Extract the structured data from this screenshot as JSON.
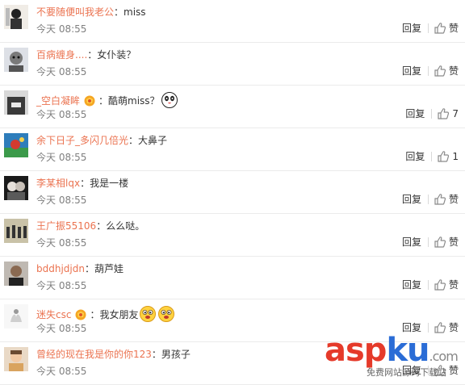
{
  "labels": {
    "reply": "回复",
    "like": "赞",
    "colon": "："
  },
  "colors": {
    "username": "#eb7350",
    "timestamp": "#808080",
    "text": "#333333"
  },
  "comments": [
    {
      "username": "不要随便叫我老公",
      "text": "miss",
      "time": "今天 08:55",
      "like": "赞",
      "badge": false,
      "emojis": []
    },
    {
      "username": "百病缠身....",
      "text": "女仆装？",
      "time": "今天 08:55",
      "like": "赞",
      "badge": false,
      "emojis": []
    },
    {
      "username": "_空白凝眸",
      "text": "酷萌miss？",
      "time": "今天 08:55",
      "like": "7",
      "badge": true,
      "emojis": [
        "panda-face-icon"
      ]
    },
    {
      "username": "余下日子_多闪几倍光",
      "text": "大鼻子",
      "time": "今天 08:55",
      "like": "1",
      "badge": false,
      "emojis": []
    },
    {
      "username": "李某相lqx",
      "text": "我是一楼",
      "time": "今天 08:55",
      "like": "赞",
      "badge": false,
      "emojis": []
    },
    {
      "username": "王广振55106",
      "text": "么么哒。",
      "time": "今天 08:55",
      "like": "赞",
      "badge": false,
      "emojis": []
    },
    {
      "username": "bddhjdjdn",
      "text": "葫芦娃",
      "time": "今天 08:55",
      "like": "赞",
      "badge": false,
      "emojis": []
    },
    {
      "username": "迷失csc",
      "text": "我女朋友",
      "time": "今天 08:55",
      "like": "赞",
      "badge": true,
      "emojis": [
        "drool-face-icon",
        "drool-face-icon"
      ]
    },
    {
      "username": "曾经的现在我是你的你123",
      "text": "男孩子",
      "time": "今天 08:55",
      "like": "赞",
      "badge": false,
      "emojis": []
    }
  ],
  "watermark": {
    "part1": "asp",
    "part2": "ku",
    "part3": ".com",
    "subtitle": "免费网站源码下载站"
  }
}
